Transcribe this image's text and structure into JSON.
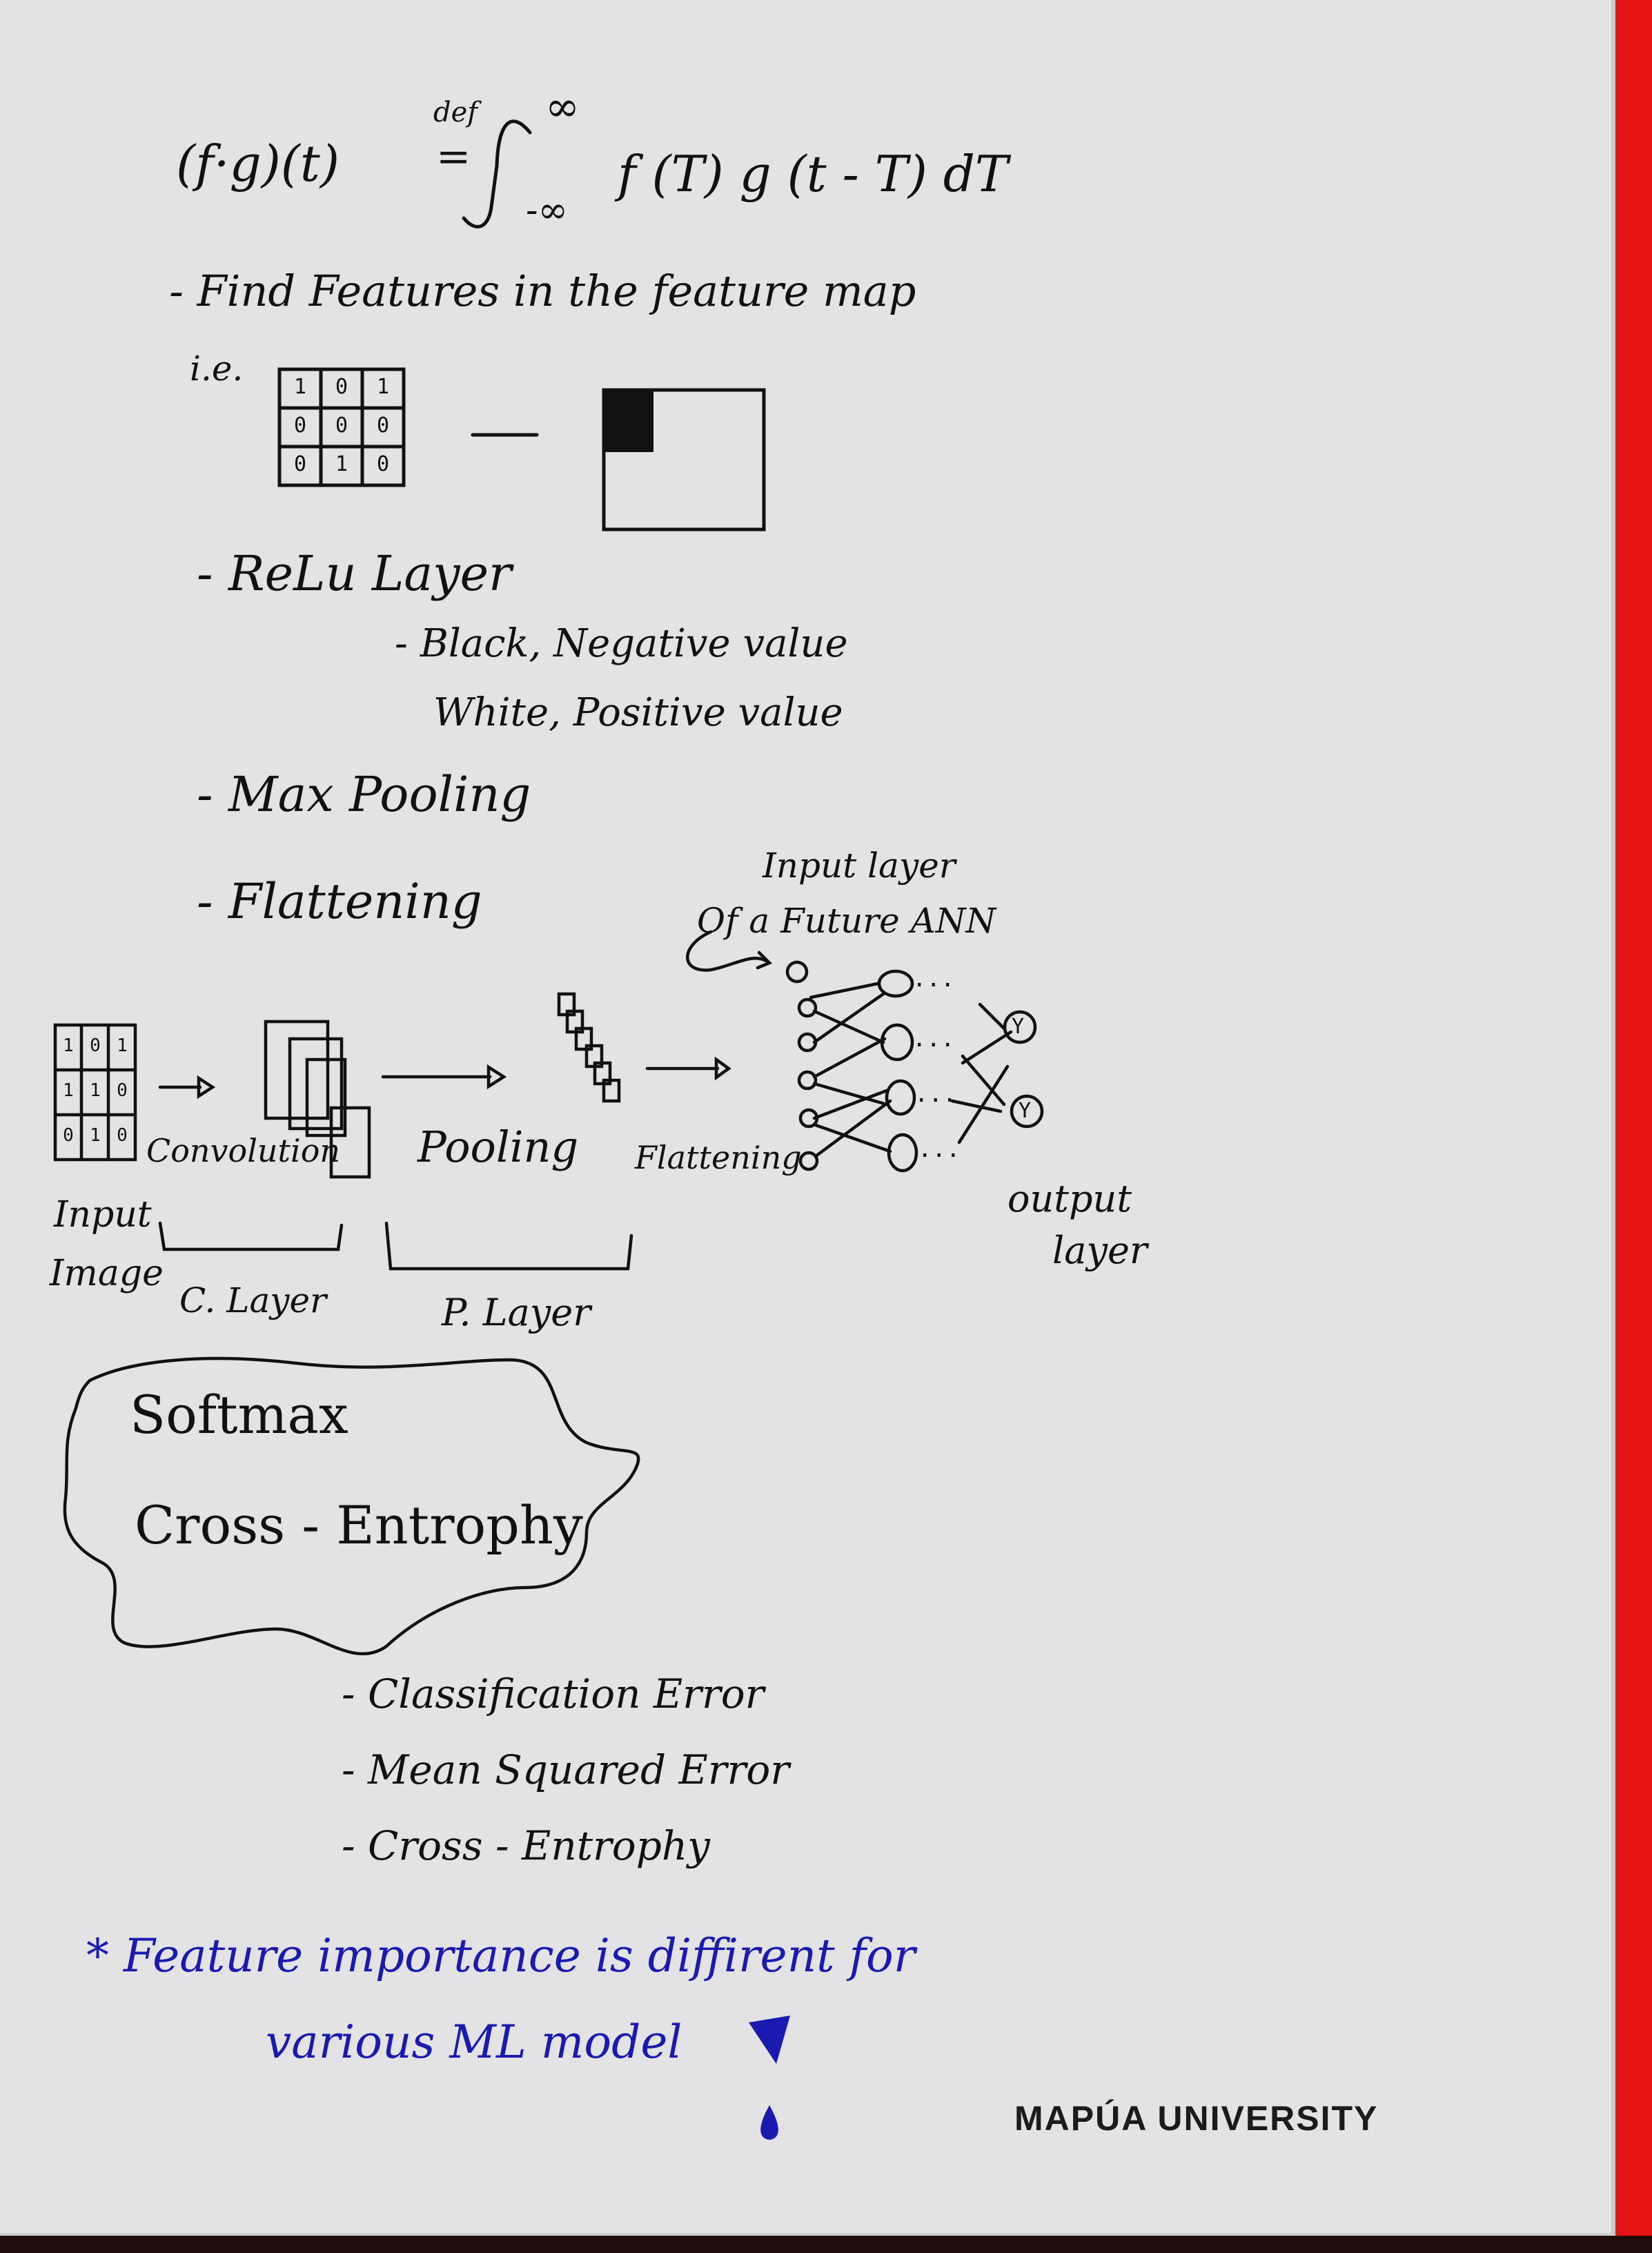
{
  "formula": {
    "lhs": "(f·g)(t)",
    "def": "def",
    "eq": "=",
    "upper": "∞",
    "lower": "-∞",
    "integrand": "f (T) g (t - T) dT"
  },
  "notes": {
    "find_features": "- Find Features in the feature map",
    "ie": "i.e.",
    "relu": "- ReLu Layer",
    "relu_black": "- Black, Negative value",
    "relu_white": "White, Positive value",
    "max_pooling": "- Max Pooling",
    "flattening": "- Flattening"
  },
  "matrix": {
    "rows": [
      [
        "1",
        "0",
        "1"
      ],
      [
        "0",
        "0",
        "0"
      ],
      [
        "0",
        "1",
        "0"
      ]
    ]
  },
  "diagram": {
    "input_matrix": [
      [
        "1",
        "0",
        "1"
      ],
      [
        "1",
        "1",
        "0"
      ],
      [
        "0",
        "1",
        "0"
      ]
    ],
    "convolution": "Convolution",
    "pooling": "Pooling",
    "flattening": "Flattening",
    "input_image_1": "Input",
    "input_image_2": "Image",
    "c_layer": "C. Layer",
    "p_layer": "P. Layer",
    "ann_label_1": "Input layer",
    "ann_label_2": "Of a Future ANN",
    "output_layer_1": "output",
    "output_layer_2": "layer",
    "out_node_1": "Y",
    "out_node_2": "Y",
    "dots": "..."
  },
  "cloud": {
    "line1": "Softmax",
    "line2": "Cross - Entrophy"
  },
  "errors": [
    "- Classification Error",
    "- Mean Squared Error",
    "- Cross - Entrophy"
  ],
  "blue_note": {
    "line1": "* Feature importance is diffirent for",
    "line2": "various ML model"
  },
  "footer": {
    "brand": "MAPÚA UNIVERSITY"
  },
  "colors": {
    "ink": "#111111",
    "blue_ink": "#1a1ab0",
    "paper": "#e3e3e5",
    "edge": "#e41414"
  }
}
